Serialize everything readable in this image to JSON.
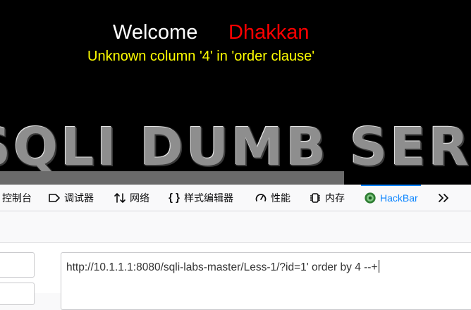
{
  "page": {
    "welcome": "Welcome",
    "user_name": "Dhakkan",
    "error_message": "Unknown column '4' in 'order clause'",
    "banner_text": "SQLI DUMB SERIES"
  },
  "devtools": {
    "tabs": [
      {
        "label": "控制台",
        "icon": "console-icon"
      },
      {
        "label": "调试器",
        "icon": "debugger-icon"
      },
      {
        "label": "网络",
        "icon": "network-icon"
      },
      {
        "label": "样式编辑器",
        "icon": "style-editor-icon"
      },
      {
        "label": "性能",
        "icon": "performance-icon"
      },
      {
        "label": "内存",
        "icon": "memory-icon"
      },
      {
        "label": "HackBar",
        "icon": "hackbar-icon"
      }
    ],
    "active_tab": "HackBar",
    "overflow_icon": "chevron-double-right-icon"
  },
  "hackbar": {
    "url_value": "http://10.1.1.1:8080/sqli-labs-master/Less-1/?id=1' order by 4 --+"
  },
  "colors": {
    "page_background": "#000000",
    "welcome": "#ffffff",
    "user_name": "#ff0000",
    "error": "#ffff00",
    "active_tab": "#0a84ff"
  }
}
